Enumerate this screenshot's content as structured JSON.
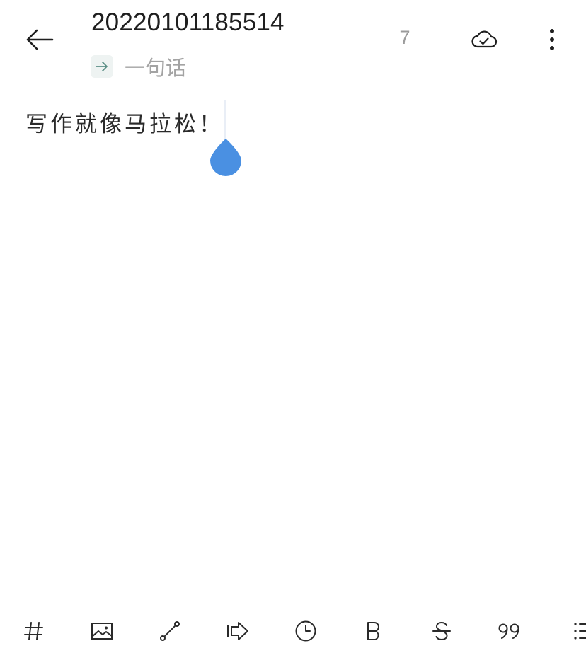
{
  "header": {
    "title": "20220101185514",
    "folder_name": "一句话",
    "word_count": "7"
  },
  "editor": {
    "content": "写作就像马拉松！"
  },
  "colors": {
    "accent_blue": "#4a90e2",
    "text_primary": "#1f1f1f",
    "text_muted": "#a3a3a3",
    "folder_chip_bg": "#eef3f2",
    "folder_arrow": "#5b8f86"
  },
  "icons": {
    "back": "arrow-left-icon",
    "folder": "arrow-right-icon",
    "sync": "cloud-check-icon",
    "more": "more-vertical-icon",
    "toolbar": [
      "hashtag-icon",
      "image-icon",
      "link-icon",
      "indent-icon",
      "clock-icon",
      "bold-icon",
      "strikethrough-icon",
      "quote-icon",
      "list-icon"
    ]
  }
}
